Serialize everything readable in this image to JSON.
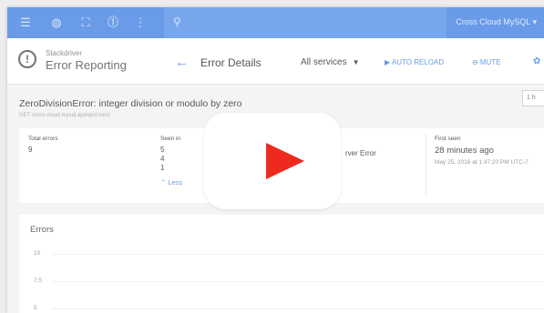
{
  "topbar": {
    "project_label": "Cross Cloud MySQL ▾",
    "icons": [
      "menu-icon",
      "globe-icon",
      "gift-icon",
      "alert-icon",
      "more-icon"
    ],
    "search_icon": "search-icon",
    "accent": "#4a86e3"
  },
  "header": {
    "product_small": "Stackdriver",
    "product_title": "Error Reporting",
    "page_title": "Error Details",
    "services_label": "All services",
    "autoreload_label": "▶ AUTO RELOAD",
    "mute_label": "⊖ MUTE"
  },
  "error": {
    "title": "ZeroDivisionError: integer division or modulo by zero",
    "subtitle": "GET cross-cloud-mysql.appspot.com/",
    "time_range": "1 h"
  },
  "stats": {
    "total_errors_label": "Total errors",
    "total_errors_value": "9",
    "seen_in_label": "Seen in",
    "seen_in_values": [
      "5",
      "4",
      "1"
    ],
    "less_label": "⌃ Less",
    "partial_text": "rver Error",
    "first_seen_label": "First seen",
    "first_seen_value": "28 minutes ago",
    "first_seen_date": "May 25, 2016 at 1:47:20 PM UTC-7"
  },
  "chart": {
    "title": "Errors",
    "ticks": [
      "10",
      "7.5",
      "5"
    ]
  },
  "overlay": {
    "play_color": "#ee2a1f"
  }
}
